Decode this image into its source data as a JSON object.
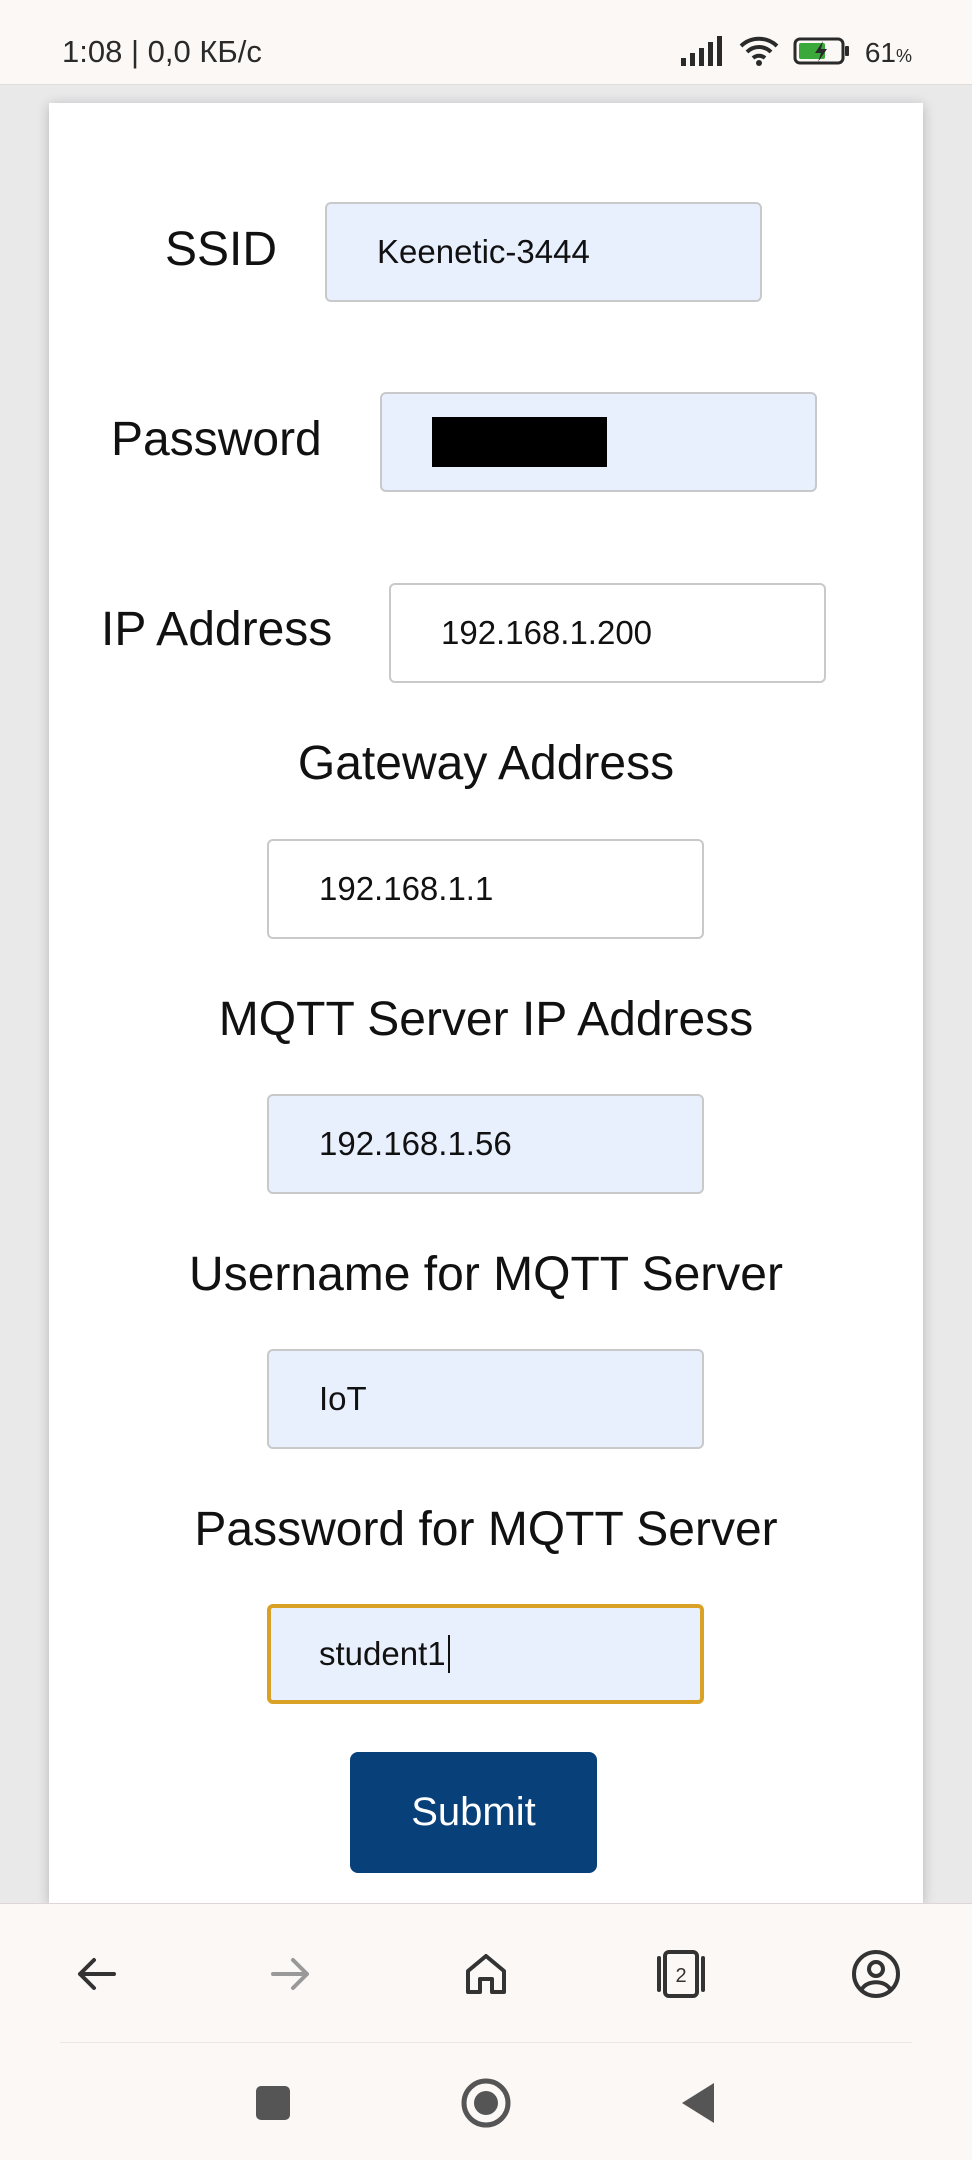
{
  "status_bar": {
    "time_speed": "1:08 | 0,0 КБ/с",
    "battery_percent": "61",
    "battery_unit": "%",
    "icons": [
      "signal-icon",
      "wifi-icon",
      "battery-charging-icon"
    ]
  },
  "form": {
    "ssid_label": "SSID",
    "ssid_value": "Keenetic-3444",
    "password_label": "Password",
    "ip_label": "IP Address",
    "ip_value": "192.168.1.200",
    "gateway_label": "Gateway Address",
    "gateway_value": "192.168.1.1",
    "mqtt_ip_label": "MQTT Server IP Address",
    "mqtt_ip_value": "192.168.1.56",
    "mqtt_user_label": "Username for MQTT Server",
    "mqtt_user_value": "IoT",
    "mqtt_pass_label": "Password for MQTT Server",
    "mqtt_pass_value": "student1",
    "submit_label": "Submit"
  },
  "browser_nav": {
    "tab_count": "2",
    "icons": [
      "back-arrow-icon",
      "forward-arrow-icon",
      "home-icon",
      "tabs-icon",
      "account-icon"
    ]
  },
  "system_nav": {
    "icons": [
      "recents-square-icon",
      "home-circle-icon",
      "back-triangle-icon"
    ]
  },
  "colors": {
    "accent_button": "#08407a",
    "autofill_bg": "#e8f0fe",
    "focus_border": "#d9a227"
  }
}
